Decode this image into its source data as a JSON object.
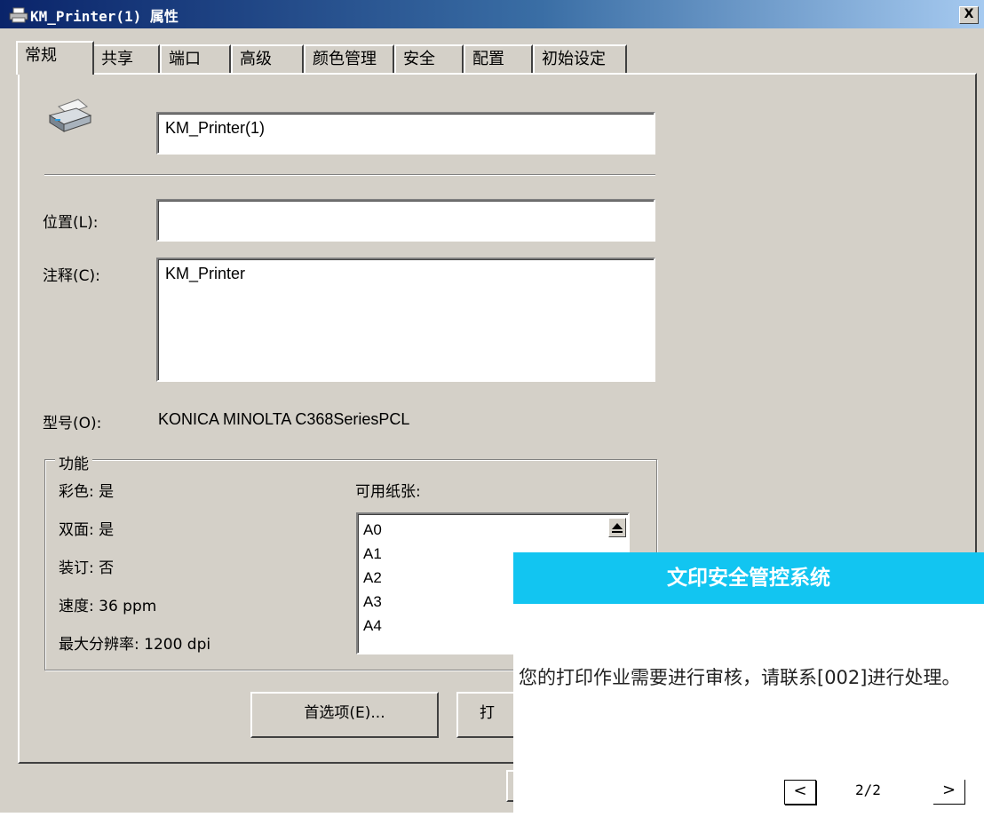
{
  "window": {
    "title": "KM_Printer(1) 属性",
    "close_label": "X"
  },
  "tabs": [
    "常规",
    "共享",
    "端口",
    "高级",
    "颜色管理",
    "安全",
    "配置",
    "初始设定"
  ],
  "general": {
    "printer_icon": "printer-icon",
    "name_value": "KM_Printer(1)",
    "location_label": "位置(L):",
    "location_value": "",
    "comment_label": "注释(C):",
    "comment_value": "KM_Printer",
    "model_label": "型号(O):",
    "model_value": "KONICA MINOLTA C368SeriesPCL"
  },
  "features": {
    "legend": "功能",
    "color": "彩色: 是",
    "duplex": "双面: 是",
    "staple": "装订: 否",
    "speed": "速度: 36 ppm",
    "max_resolution": "最大分辨率: 1200 dpi",
    "paper_label": "可用纸张:",
    "papers": [
      "A0",
      "A1",
      "A2",
      "A3",
      "A4"
    ]
  },
  "buttons": {
    "preferences": "首选项(E)...",
    "print_test": "打"
  },
  "popup": {
    "header": "文印安全管控系统",
    "message": "您的打印作业需要进行审核，请联系[002]进行处理。",
    "prev": "<",
    "next": ">",
    "page": "2/2",
    "header_color": "#12c5f1"
  }
}
